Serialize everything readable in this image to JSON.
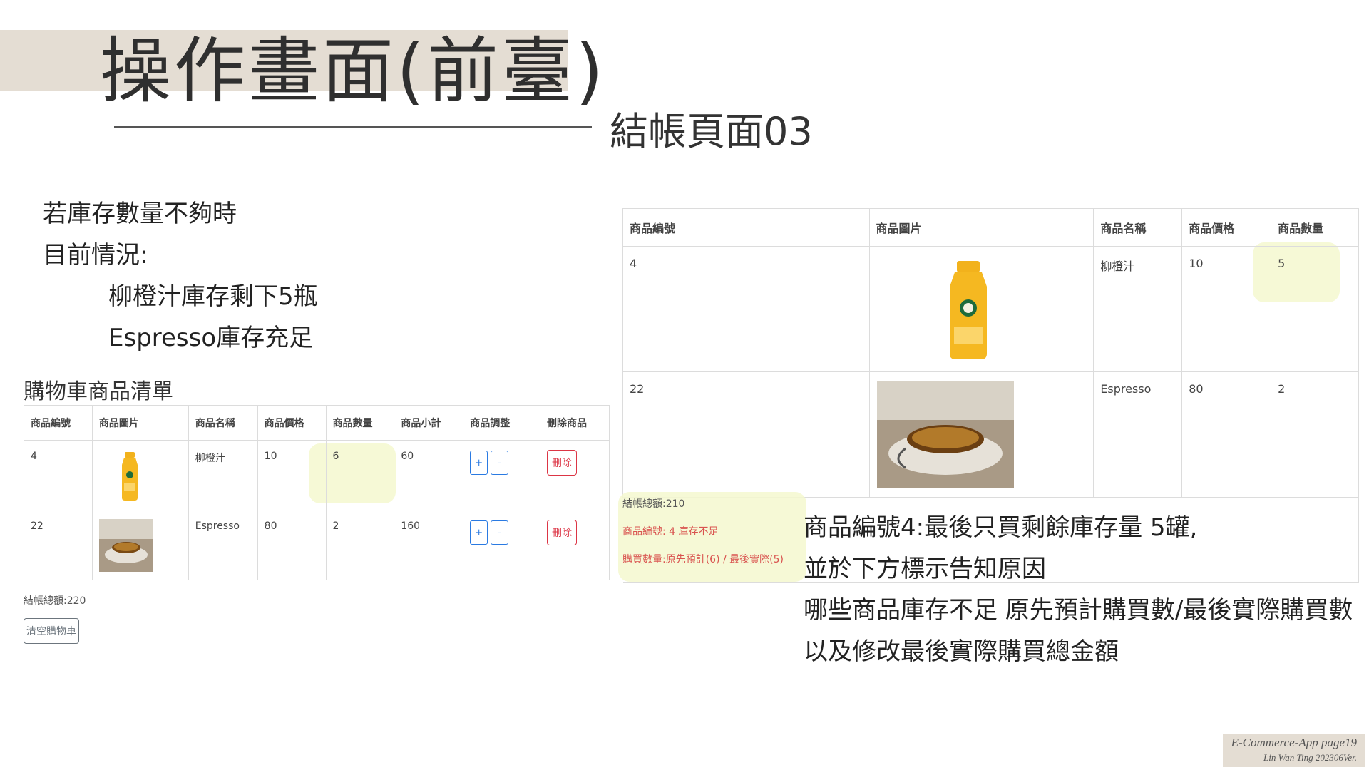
{
  "header": {
    "title": "操作畫面(前臺)",
    "subtitle": "結帳頁面03"
  },
  "notes": {
    "line1": "若庫存數量不夠時",
    "line2": "目前情況:",
    "line3": "柳橙汁庫存剩下5瓶",
    "line4": "Espresso庫存充足"
  },
  "cart": {
    "heading": "購物車商品清單",
    "columns": [
      "商品編號",
      "商品圖片",
      "商品名稱",
      "商品價格",
      "商品數量",
      "商品小計",
      "商品調整",
      "刪除商品"
    ],
    "rows": [
      {
        "id": "4",
        "name": "柳橙汁",
        "price": "10",
        "qty": "6",
        "subtotal": "60"
      },
      {
        "id": "22",
        "name": "Espresso",
        "price": "80",
        "qty": "2",
        "subtotal": "160"
      }
    ],
    "plus_label": "+",
    "minus_label": "-",
    "delete_label": "刪除",
    "total": "結帳總額:220",
    "clear_label": "清空購物車"
  },
  "checkout": {
    "columns": [
      "商品編號",
      "商品圖片",
      "商品名稱",
      "商品價格",
      "商品數量"
    ],
    "rows": [
      {
        "id": "4",
        "name": "柳橙汁",
        "price": "10",
        "qty": "5"
      },
      {
        "id": "22",
        "name": "Espresso",
        "price": "80",
        "qty": "2"
      }
    ],
    "total": "結帳總額:210",
    "warning1": "商品編號: 4 庫存不足",
    "warning2": "購買數量:原先預計(6) / 最後實際(5)"
  },
  "explanation": {
    "line1": "商品編號4:最後只買剩餘庫存量 5罐,",
    "line2": "並於下方標示告知原因",
    "line3": "哪些商品庫存不足 原先預計購買數/最後實際購買數",
    "line4": "以及修改最後實際購買總金額"
  },
  "footer": {
    "line1": "E-Commerce-App page19",
    "line2": "Lin Wan Ting 202306Ver."
  },
  "colors": {
    "title_band": "#e4ddd3",
    "highlight": "#f5f8cf",
    "warning_text": "#d9534f",
    "button_blue": "#2a7ae2",
    "button_red": "#dc3545"
  }
}
